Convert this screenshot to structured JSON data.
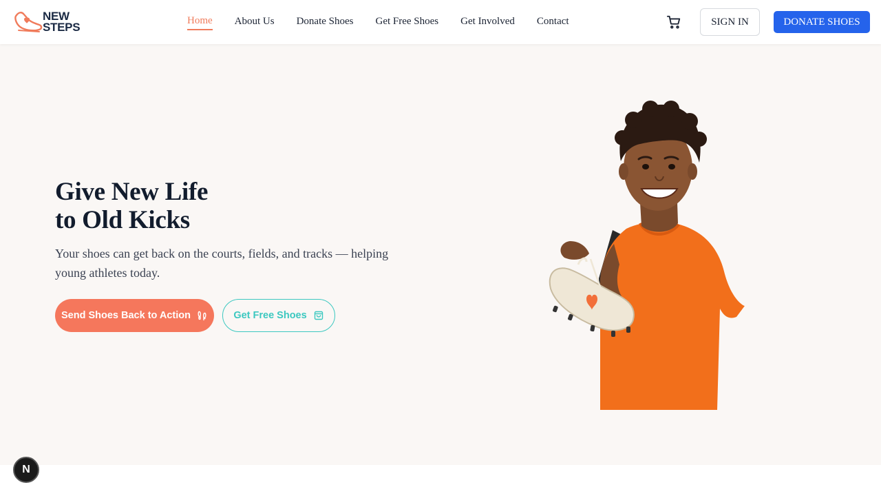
{
  "brand": {
    "line1": "NEW",
    "line2": "STEPS",
    "accent": "#f07b5b",
    "navy": "#1b2a44"
  },
  "nav": {
    "items": [
      {
        "label": "Home",
        "active": true
      },
      {
        "label": "About Us"
      },
      {
        "label": "Donate Shoes"
      },
      {
        "label": "Get Free Shoes"
      },
      {
        "label": "Get Involved"
      },
      {
        "label": "Contact"
      }
    ]
  },
  "header": {
    "cart_icon": "cart-icon",
    "signin_label": "SIGN IN",
    "donate_label": "DONATE SHOES",
    "donate_color": "#2563eb"
  },
  "hero": {
    "title_line1": "Give New Life",
    "title_line2": "to Old Kicks",
    "subtitle": "Your shoes can get back on the courts, fields, and tracks — helping young athletes today.",
    "primary_cta": "Send Shoes Back to Action",
    "primary_icon": "footprints-icon",
    "secondary_cta": "Get Free Shoes",
    "secondary_icon": "shopping-bag-icon",
    "primary_color": "#f5775c",
    "secondary_color": "#3cc8c0",
    "background": "#faf7f5"
  },
  "dev_badge": {
    "label": "N"
  }
}
